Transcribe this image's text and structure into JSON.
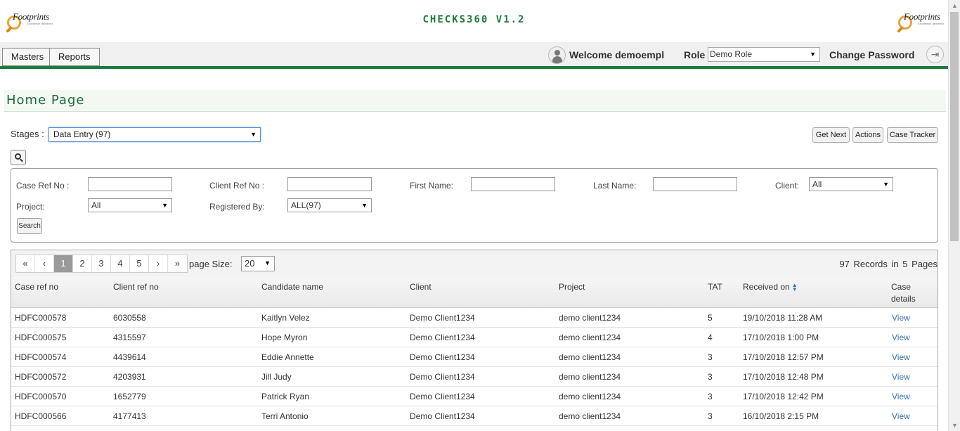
{
  "header": {
    "app_title": "CHECKS360 V1.2",
    "logo_text": "Footprints",
    "logo_subtext": "Excellence delivered"
  },
  "nav": {
    "tabs": [
      "Masters",
      "Reports"
    ],
    "welcome": "Welcome demoempl",
    "role_label": "Role",
    "role_value": "Demo Role",
    "change_password": "Change Password"
  },
  "page": {
    "title": "Home Page",
    "stages_label": "Stages :",
    "stages_value": "Data Entry (97)",
    "buttons": {
      "get_next": "Get Next",
      "actions": "Actions",
      "case_tracker": "Case Tracker"
    }
  },
  "filters": {
    "case_ref_label": "Case Ref No :",
    "client_ref_label": "Client Ref No :",
    "first_name_label": "First Name:",
    "last_name_label": "Last Name:",
    "client_label": "Client:",
    "client_value": "All",
    "project_label": "Project:",
    "project_value": "All",
    "registered_by_label": "Registered By:",
    "registered_by_value": "ALL(97)",
    "search_button": "Search"
  },
  "pager": {
    "first": "«",
    "prev": "‹",
    "pages": [
      "1",
      "2",
      "3",
      "4",
      "5"
    ],
    "active_page": "1",
    "next": "›",
    "last": "»",
    "page_size_label": "page Size:",
    "page_size_value": "20",
    "records_count": "97",
    "records_text": "Records in",
    "pages_count": "5",
    "pages_text": "Pages"
  },
  "table": {
    "headers": {
      "case_ref": "Case ref no",
      "client_ref": "Client ref no",
      "candidate": "Candidate name",
      "client": "Client",
      "project": "Project",
      "tat": "TAT",
      "received": "Received on",
      "details_1": "Case",
      "details_2": "details"
    },
    "rows": [
      {
        "case_ref": "HDFC000578",
        "client_ref": "6030558",
        "candidate": "Kaitlyn Velez",
        "client": "Demo Client1234",
        "project": "demo client1234",
        "tat": "5",
        "received": "19/10/2018 11:28 AM",
        "link": "View"
      },
      {
        "case_ref": "HDFC000575",
        "client_ref": "4315597",
        "candidate": "Hope Myron",
        "client": "Demo Client1234",
        "project": "demo client1234",
        "tat": "4",
        "received": "17/10/2018 1:00 PM",
        "link": "View"
      },
      {
        "case_ref": "HDFC000574",
        "client_ref": "4439614",
        "candidate": "Eddie Annette",
        "client": "Demo Client1234",
        "project": "demo client1234",
        "tat": "3",
        "received": "17/10/2018 12:57 PM",
        "link": "View"
      },
      {
        "case_ref": "HDFC000572",
        "client_ref": "4203931",
        "candidate": "Jill Judy",
        "client": "Demo Client1234",
        "project": "demo client1234",
        "tat": "3",
        "received": "17/10/2018 12:48 PM",
        "link": "View"
      },
      {
        "case_ref": "HDFC000570",
        "client_ref": "1652779",
        "candidate": "Patrick Ryan",
        "client": "Demo Client1234",
        "project": "demo client1234",
        "tat": "3",
        "received": "17/10/2018 12:42 PM",
        "link": "View"
      },
      {
        "case_ref": "HDFC000566",
        "client_ref": "4177413",
        "candidate": "Terri Antonio",
        "client": "Demo Client1234",
        "project": "demo client1234",
        "tat": "3",
        "received": "16/10/2018 2:15 PM",
        "link": "View"
      }
    ]
  },
  "icons": {
    "user": "user-icon",
    "logout": "logout-icon",
    "search": "search-icon",
    "sort": "sort-icon",
    "dropdown": "caret-down-icon"
  },
  "colors": {
    "brand_green": "#1d7a3a",
    "link_blue": "#3a70b6",
    "active_page": "#9a9a9a"
  }
}
